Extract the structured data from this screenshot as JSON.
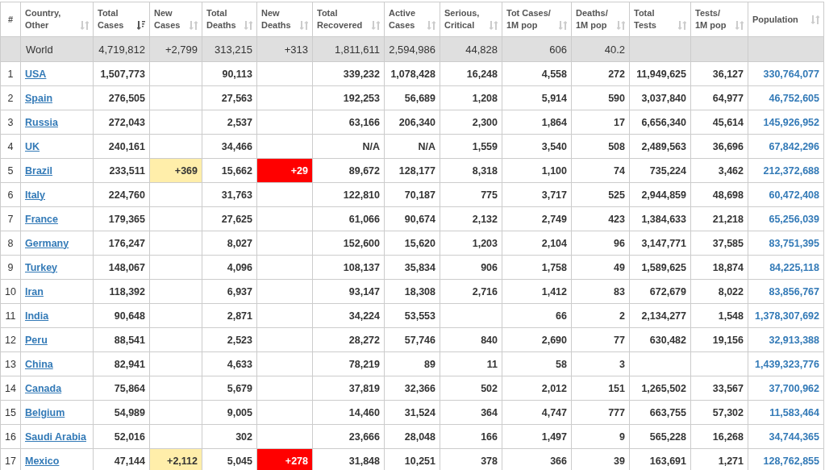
{
  "table": {
    "columns": [
      {
        "label": "#"
      },
      {
        "label": "Country,\nOther",
        "sorted": false
      },
      {
        "label": "Total\nCases",
        "sorted": true
      },
      {
        "label": "New\nCases",
        "sorted": false
      },
      {
        "label": "Total\nDeaths",
        "sorted": false
      },
      {
        "label": "New\nDeaths",
        "sorted": false
      },
      {
        "label": "Total\nRecovered",
        "sorted": false
      },
      {
        "label": "Active\nCases",
        "sorted": false
      },
      {
        "label": "Serious,\nCritical",
        "sorted": false
      },
      {
        "label": "Tot Cases/\n1M pop",
        "sorted": false
      },
      {
        "label": "Deaths/\n1M pop",
        "sorted": false
      },
      {
        "label": "Total\nTests",
        "sorted": false
      },
      {
        "label": "Tests/\n1M pop",
        "sorted": false
      },
      {
        "label": "Population",
        "sorted": false
      }
    ],
    "total_row": {
      "country": "World",
      "total_cases": "4,719,812",
      "new_cases": "+2,799",
      "total_deaths": "313,215",
      "new_deaths": "+313",
      "total_recovered": "1,811,611",
      "active_cases": "2,594,986",
      "serious_critical": "44,828",
      "tot_cases_per_1m": "606",
      "deaths_per_1m": "40.2"
    },
    "rows": [
      {
        "rank": "1",
        "country": "USA",
        "total_cases": "1,507,773",
        "total_deaths": "90,113",
        "total_recovered": "339,232",
        "active_cases": "1,078,428",
        "serious_critical": "16,248",
        "tot_cases_per_1m": "4,558",
        "deaths_per_1m": "272",
        "total_tests": "11,949,625",
        "tests_per_1m": "36,127",
        "population": "330,764,077"
      },
      {
        "rank": "2",
        "country": "Spain",
        "total_cases": "276,505",
        "total_deaths": "27,563",
        "total_recovered": "192,253",
        "active_cases": "56,689",
        "serious_critical": "1,208",
        "tot_cases_per_1m": "5,914",
        "deaths_per_1m": "590",
        "total_tests": "3,037,840",
        "tests_per_1m": "64,977",
        "population": "46,752,605"
      },
      {
        "rank": "3",
        "country": "Russia",
        "total_cases": "272,043",
        "total_deaths": "2,537",
        "total_recovered": "63,166",
        "active_cases": "206,340",
        "serious_critical": "2,300",
        "tot_cases_per_1m": "1,864",
        "deaths_per_1m": "17",
        "total_tests": "6,656,340",
        "tests_per_1m": "45,614",
        "population": "145,926,952"
      },
      {
        "rank": "4",
        "country": "UK",
        "total_cases": "240,161",
        "total_deaths": "34,466",
        "total_recovered": "N/A",
        "active_cases": "N/A",
        "serious_critical": "1,559",
        "tot_cases_per_1m": "3,540",
        "deaths_per_1m": "508",
        "total_tests": "2,489,563",
        "tests_per_1m": "36,696",
        "population": "67,842,296"
      },
      {
        "rank": "5",
        "country": "Brazil",
        "total_cases": "233,511",
        "new_cases": "+369",
        "total_deaths": "15,662",
        "new_deaths": "+29",
        "total_recovered": "89,672",
        "active_cases": "128,177",
        "serious_critical": "8,318",
        "tot_cases_per_1m": "1,100",
        "deaths_per_1m": "74",
        "total_tests": "735,224",
        "tests_per_1m": "3,462",
        "population": "212,372,688"
      },
      {
        "rank": "6",
        "country": "Italy",
        "total_cases": "224,760",
        "total_deaths": "31,763",
        "total_recovered": "122,810",
        "active_cases": "70,187",
        "serious_critical": "775",
        "tot_cases_per_1m": "3,717",
        "deaths_per_1m": "525",
        "total_tests": "2,944,859",
        "tests_per_1m": "48,698",
        "population": "60,472,408"
      },
      {
        "rank": "7",
        "country": "France",
        "total_cases": "179,365",
        "total_deaths": "27,625",
        "total_recovered": "61,066",
        "active_cases": "90,674",
        "serious_critical": "2,132",
        "tot_cases_per_1m": "2,749",
        "deaths_per_1m": "423",
        "total_tests": "1,384,633",
        "tests_per_1m": "21,218",
        "population": "65,256,039"
      },
      {
        "rank": "8",
        "country": "Germany",
        "total_cases": "176,247",
        "total_deaths": "8,027",
        "total_recovered": "152,600",
        "active_cases": "15,620",
        "serious_critical": "1,203",
        "tot_cases_per_1m": "2,104",
        "deaths_per_1m": "96",
        "total_tests": "3,147,771",
        "tests_per_1m": "37,585",
        "population": "83,751,395"
      },
      {
        "rank": "9",
        "country": "Turkey",
        "total_cases": "148,067",
        "total_deaths": "4,096",
        "total_recovered": "108,137",
        "active_cases": "35,834",
        "serious_critical": "906",
        "tot_cases_per_1m": "1,758",
        "deaths_per_1m": "49",
        "total_tests": "1,589,625",
        "tests_per_1m": "18,874",
        "population": "84,225,118"
      },
      {
        "rank": "10",
        "country": "Iran",
        "total_cases": "118,392",
        "total_deaths": "6,937",
        "total_recovered": "93,147",
        "active_cases": "18,308",
        "serious_critical": "2,716",
        "tot_cases_per_1m": "1,412",
        "deaths_per_1m": "83",
        "total_tests": "672,679",
        "tests_per_1m": "8,022",
        "population": "83,856,767"
      },
      {
        "rank": "11",
        "country": "India",
        "total_cases": "90,648",
        "total_deaths": "2,871",
        "total_recovered": "34,224",
        "active_cases": "53,553",
        "tot_cases_per_1m": "66",
        "deaths_per_1m": "2",
        "total_tests": "2,134,277",
        "tests_per_1m": "1,548",
        "population": "1,378,307,692"
      },
      {
        "rank": "12",
        "country": "Peru",
        "total_cases": "88,541",
        "total_deaths": "2,523",
        "total_recovered": "28,272",
        "active_cases": "57,746",
        "serious_critical": "840",
        "tot_cases_per_1m": "2,690",
        "deaths_per_1m": "77",
        "total_tests": "630,482",
        "tests_per_1m": "19,156",
        "population": "32,913,388"
      },
      {
        "rank": "13",
        "country": "China",
        "total_cases": "82,941",
        "total_deaths": "4,633",
        "total_recovered": "78,219",
        "active_cases": "89",
        "serious_critical": "11",
        "tot_cases_per_1m": "58",
        "deaths_per_1m": "3",
        "population": "1,439,323,776"
      },
      {
        "rank": "14",
        "country": "Canada",
        "total_cases": "75,864",
        "total_deaths": "5,679",
        "total_recovered": "37,819",
        "active_cases": "32,366",
        "serious_critical": "502",
        "tot_cases_per_1m": "2,012",
        "deaths_per_1m": "151",
        "total_tests": "1,265,502",
        "tests_per_1m": "33,567",
        "population": "37,700,962"
      },
      {
        "rank": "15",
        "country": "Belgium",
        "total_cases": "54,989",
        "total_deaths": "9,005",
        "total_recovered": "14,460",
        "active_cases": "31,524",
        "serious_critical": "364",
        "tot_cases_per_1m": "4,747",
        "deaths_per_1m": "777",
        "total_tests": "663,755",
        "tests_per_1m": "57,302",
        "population": "11,583,464"
      },
      {
        "rank": "16",
        "country": "Saudi Arabia",
        "total_cases": "52,016",
        "total_deaths": "302",
        "total_recovered": "23,666",
        "active_cases": "28,048",
        "serious_critical": "166",
        "tot_cases_per_1m": "1,497",
        "deaths_per_1m": "9",
        "total_tests": "565,228",
        "tests_per_1m": "16,268",
        "population": "34,744,365"
      },
      {
        "rank": "17",
        "country": "Mexico",
        "total_cases": "47,144",
        "new_cases": "+2,112",
        "total_deaths": "5,045",
        "new_deaths": "+278",
        "total_recovered": "31,848",
        "active_cases": "10,251",
        "serious_critical": "378",
        "tot_cases_per_1m": "366",
        "deaths_per_1m": "39",
        "total_tests": "163,691",
        "tests_per_1m": "1,271",
        "population": "128,762,855"
      }
    ]
  }
}
